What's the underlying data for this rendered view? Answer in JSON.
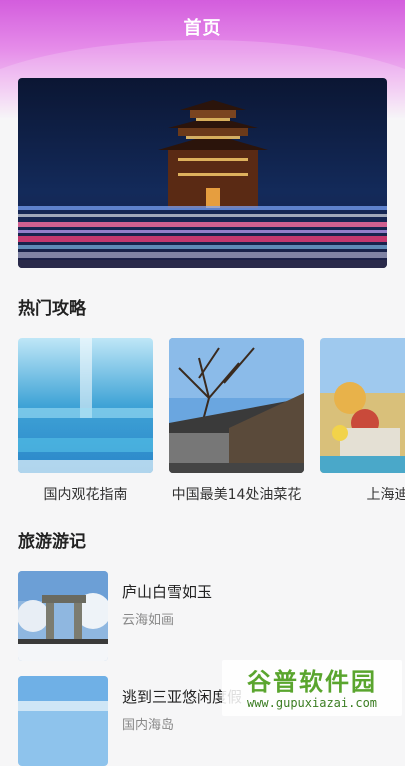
{
  "header": {
    "title": "首页"
  },
  "sections": {
    "hot_guides_title": "热门攻略",
    "travel_notes_title": "旅游游记"
  },
  "hot_guides": [
    {
      "label": "国内观花指南"
    },
    {
      "label": "中国最美14处油菜花"
    },
    {
      "label": "上海迪"
    }
  ],
  "travel_notes": [
    {
      "title": "庐山白雪如玉",
      "subtitle": "云海如画"
    },
    {
      "title": "逃到三亚悠闲度假",
      "subtitle": "国内海岛"
    }
  ],
  "watermark": {
    "text": "谷普软件园",
    "url": "www.gupuxiazai.com"
  },
  "colors": {
    "header_accent": "#d35ddd",
    "background": "#f6f6f7"
  }
}
